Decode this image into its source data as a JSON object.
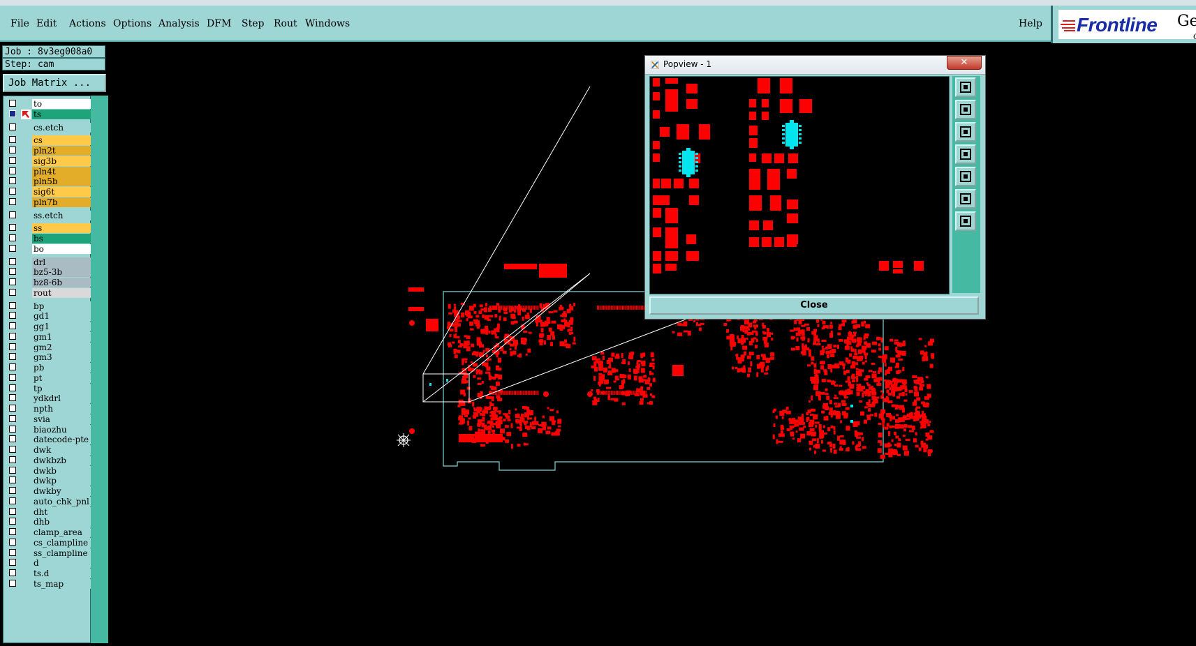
{
  "menu": {
    "items": [
      {
        "label": "File"
      },
      {
        "label": "Edit"
      },
      {
        "label": "Actions"
      },
      {
        "label": "Options"
      },
      {
        "label": "Analysis"
      },
      {
        "label": "DFM"
      },
      {
        "label": "Step"
      },
      {
        "label": "Rout"
      },
      {
        "label": "Windows"
      }
    ],
    "help": "Help"
  },
  "logo": {
    "brand": "Frontline",
    "product_partial": "Ger",
    "sub_partial": "Gr"
  },
  "job": {
    "job_label": "Job : 8v3eg008a0",
    "step_label": "Step: cam",
    "matrix_button": "Job Matrix ..."
  },
  "layers": [
    {
      "name": "to",
      "color": "#ffffff"
    },
    {
      "name": "ts",
      "color": "#1ea37a",
      "selected": true
    },
    {
      "name": "cs.etch",
      "color": "#9ed6d6"
    },
    {
      "name": "cs",
      "color": "#ffc94a"
    },
    {
      "name": "pln2t",
      "color": "#e3ad2a"
    },
    {
      "name": "sig3b",
      "color": "#ffc94a"
    },
    {
      "name": "pln4t",
      "color": "#e3ad2a"
    },
    {
      "name": "pln5b",
      "color": "#e3ad2a"
    },
    {
      "name": "sig6t",
      "color": "#ffc94a"
    },
    {
      "name": "pln7b",
      "color": "#e3ad2a"
    },
    {
      "name": "ss.etch",
      "color": "#9ed6d6"
    },
    {
      "name": "ss",
      "color": "#ffc94a"
    },
    {
      "name": "bs",
      "color": "#1ea37a"
    },
    {
      "name": "bo",
      "color": "#ffffff"
    },
    {
      "name": "drl",
      "color": "#a9bcc4"
    },
    {
      "name": "bz5-3b",
      "color": "#a9bcc4"
    },
    {
      "name": "bz8-6b",
      "color": "#a9bcc4"
    },
    {
      "name": "rout",
      "color": "#d9d9d9"
    },
    {
      "name": "bp",
      "color": "#9ed6d6"
    },
    {
      "name": "gd1",
      "color": "#9ed6d6"
    },
    {
      "name": "gg1",
      "color": "#9ed6d6"
    },
    {
      "name": "gm1",
      "color": "#9ed6d6"
    },
    {
      "name": "gm2",
      "color": "#9ed6d6"
    },
    {
      "name": "gm3",
      "color": "#9ed6d6"
    },
    {
      "name": "pb",
      "color": "#9ed6d6"
    },
    {
      "name": "pt",
      "color": "#9ed6d6"
    },
    {
      "name": "tp",
      "color": "#9ed6d6"
    },
    {
      "name": "ydkdrl",
      "color": "#9ed6d6"
    },
    {
      "name": "npth",
      "color": "#9ed6d6"
    },
    {
      "name": "svia",
      "color": "#9ed6d6"
    },
    {
      "name": "biaozhu",
      "color": "#9ed6d6"
    },
    {
      "name": "datecode-pte",
      "color": "#9ed6d6"
    },
    {
      "name": "dwk",
      "color": "#9ed6d6"
    },
    {
      "name": "dwkbzb",
      "color": "#9ed6d6"
    },
    {
      "name": "dwkb",
      "color": "#9ed6d6"
    },
    {
      "name": "dwkp",
      "color": "#9ed6d6"
    },
    {
      "name": "dwkby",
      "color": "#9ed6d6"
    },
    {
      "name": "auto_chk_pnl",
      "color": "#9ed6d6"
    },
    {
      "name": "dht",
      "color": "#9ed6d6"
    },
    {
      "name": "dhb",
      "color": "#9ed6d6"
    },
    {
      "name": "clamp_area",
      "color": "#9ed6d6"
    },
    {
      "name": "cs_clampline",
      "color": "#9ed6d6"
    },
    {
      "name": "ss_clampline",
      "color": "#9ed6d6"
    },
    {
      "name": "d",
      "color": "#9ed6d6"
    },
    {
      "name": "ts.d",
      "color": "#9ed6d6"
    },
    {
      "name": "ts_map",
      "color": "#9ed6d6"
    }
  ],
  "popview": {
    "title": "Popview - 1",
    "close_x": "✕",
    "close_button": "Close",
    "tools": [
      "zoom-home-icon",
      "scroll-up-icon",
      "scroll-down-icon",
      "scroll-left-icon",
      "scroll-right-icon",
      "zoom-fit-icon",
      "pan-center-icon"
    ]
  },
  "colors": {
    "pad": "#ff0000",
    "outline": "#7fd6d6",
    "highlight": "#00e5ee",
    "panel": "#9ed6d6"
  }
}
